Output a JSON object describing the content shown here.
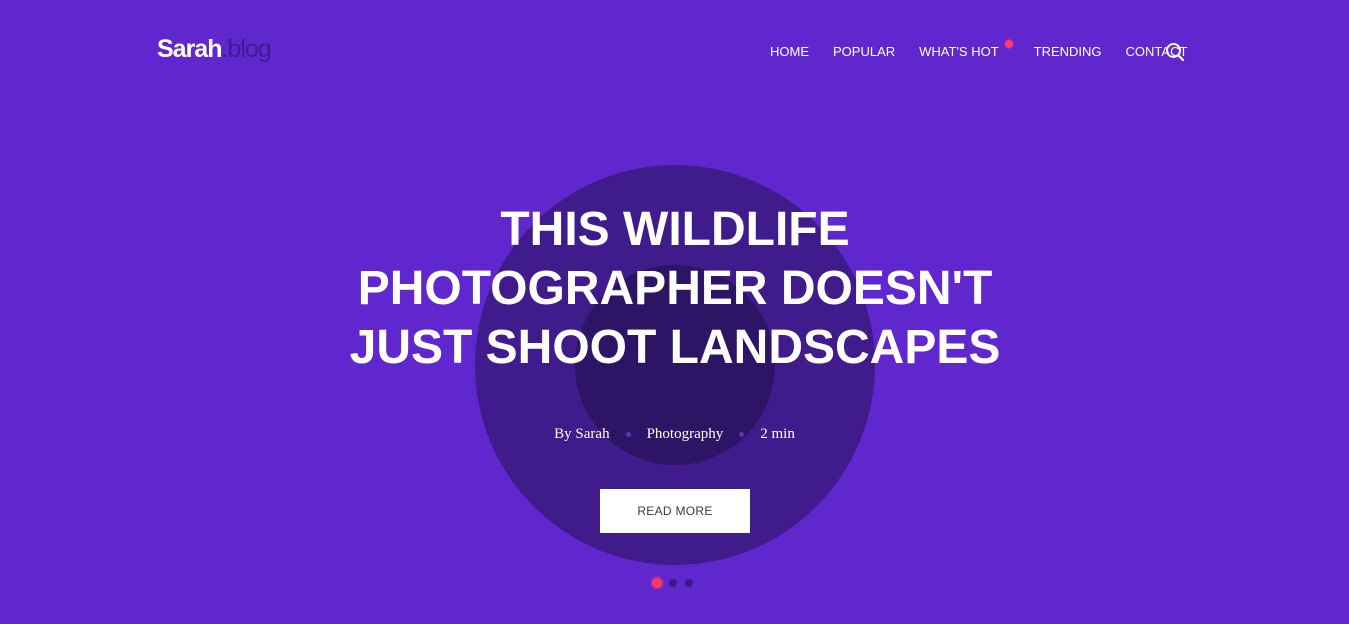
{
  "logo": {
    "main": "Sarah",
    "suffix": ".blog"
  },
  "nav": {
    "items": [
      {
        "label": "HOME"
      },
      {
        "label": "POPULAR"
      },
      {
        "label": "WHAT'S HOT",
        "badge": "new-dot"
      },
      {
        "label": "TRENDING"
      },
      {
        "label": "CONTACT"
      }
    ],
    "search_icon": "search-icon"
  },
  "hero": {
    "title": "THIS WILDLIFE PHOTOGRAPHER DOESN'T JUST SHOOT LANDSCAPES",
    "meta": {
      "author": "By Sarah",
      "category": "Photography",
      "read_time": "2 min"
    },
    "button_label": "READ MORE"
  },
  "slider": {
    "count": 3,
    "active_index": 0
  },
  "colors": {
    "background": "#6027cf",
    "ring_outer": "#401b8c",
    "ring_inner": "#2e1464",
    "accent": "#ff3a6b",
    "text": "#ffffff"
  }
}
